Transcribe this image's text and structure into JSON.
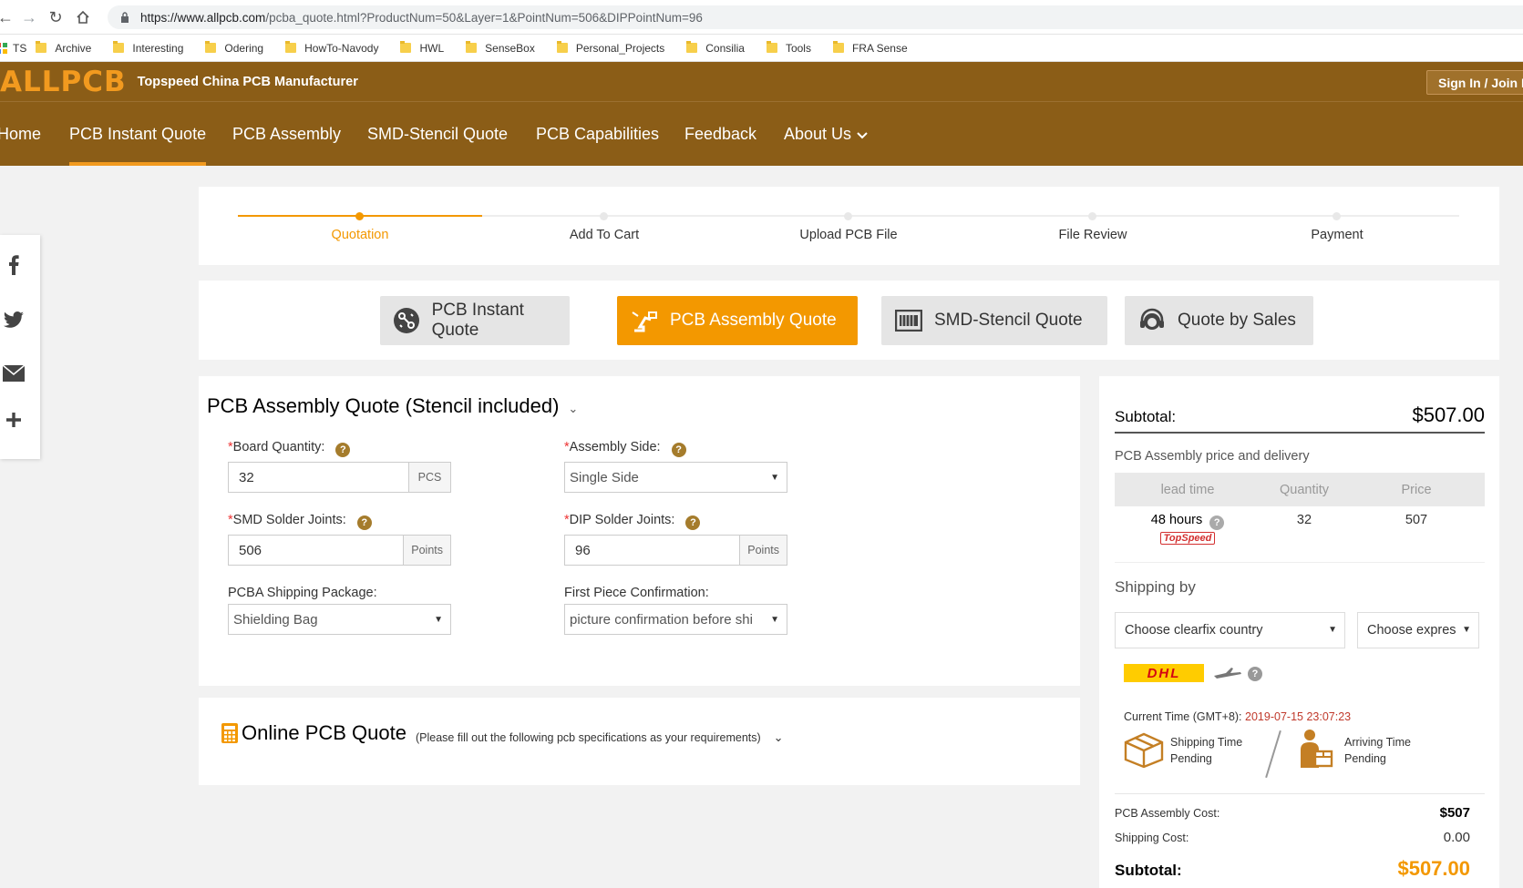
{
  "browser": {
    "url_host": "https://www.allpcb.com",
    "url_path": "/pcba_quote.html?ProductNum=50&Layer=1&PointNum=506&DIPPointNum=96",
    "bookmarks": [
      "TS",
      "Archive",
      "Interesting",
      "Odering",
      "HowTo-Navody",
      "HWL",
      "SenseBox",
      "Personal_Projects",
      "Consilia",
      "Tools",
      "FRA Sense"
    ]
  },
  "header": {
    "logo": "ALLPCB",
    "tagline": "Topspeed China PCB Manufacturer",
    "signin": "Sign In / Join F"
  },
  "nav": {
    "items": [
      "Home",
      "PCB Instant Quote",
      "PCB Assembly",
      "SMD-Stencil Quote",
      "PCB Capabilities",
      "Feedback",
      "About Us"
    ],
    "active": "PCB Instant Quote"
  },
  "steps": [
    "Quotation",
    "Add To Cart",
    "Upload PCB File",
    "File Review",
    "Payment"
  ],
  "tabs": [
    "PCB Instant Quote",
    "PCB Assembly Quote",
    "SMD-Stencil Quote",
    "Quote by Sales"
  ],
  "form": {
    "title": "PCB Assembly Quote (Stencil included)",
    "board_quantity": {
      "label": "Board Quantity:",
      "value": "32",
      "unit": "PCS"
    },
    "assembly_side": {
      "label": "Assembly Side:",
      "value": "Single Side"
    },
    "smd_joints": {
      "label": "SMD Solder Joints:",
      "value": "506",
      "unit": "Points"
    },
    "dip_joints": {
      "label": "DIP Solder Joints:",
      "value": "96",
      "unit": "Points"
    },
    "shipping_package": {
      "label": "PCBA Shipping Package:",
      "value": "Shielding Bag"
    },
    "first_piece": {
      "label": "First Piece Confirmation:",
      "value": "picture confirmation before shi"
    }
  },
  "online": {
    "title": "Online PCB Quote",
    "note": "(Please fill out the following pcb specifications as your requirements)"
  },
  "summary": {
    "subtotal_label": "Subtotal:",
    "subtotal_value": "$507.00",
    "price_delivery_title": "PCB Assembly price and delivery",
    "table_headers": [
      "lead time",
      "Quantity",
      "Price"
    ],
    "table_row": {
      "lead_time": "48 hours",
      "badge": "TopSpeed",
      "quantity": "32",
      "price": "507"
    },
    "shipping_title": "Shipping by",
    "country_select": "Choose clearfix country",
    "express_select": "Choose expres",
    "carrier": "DHL",
    "current_time_label": "Current Time (GMT+8):",
    "current_time_value": "2019-07-15 23:07:23",
    "shipping_time_label": "Shipping Time",
    "shipping_time_value": "Pending",
    "arriving_time_label": "Arriving Time",
    "arriving_time_value": "Pending",
    "assembly_cost_label": "PCB Assembly Cost:",
    "assembly_cost_value": "$507",
    "shipping_cost_label": "Shipping Cost:",
    "shipping_cost_value": "0.00",
    "bottom_subtotal_label": "Subtotal:",
    "bottom_subtotal_value": "$507.00"
  },
  "colors": {
    "brand_brown": "#8b5d17",
    "accent_orange": "#f39800",
    "help_icon": "#a57c2c",
    "time_highlight": "#c0392b"
  }
}
